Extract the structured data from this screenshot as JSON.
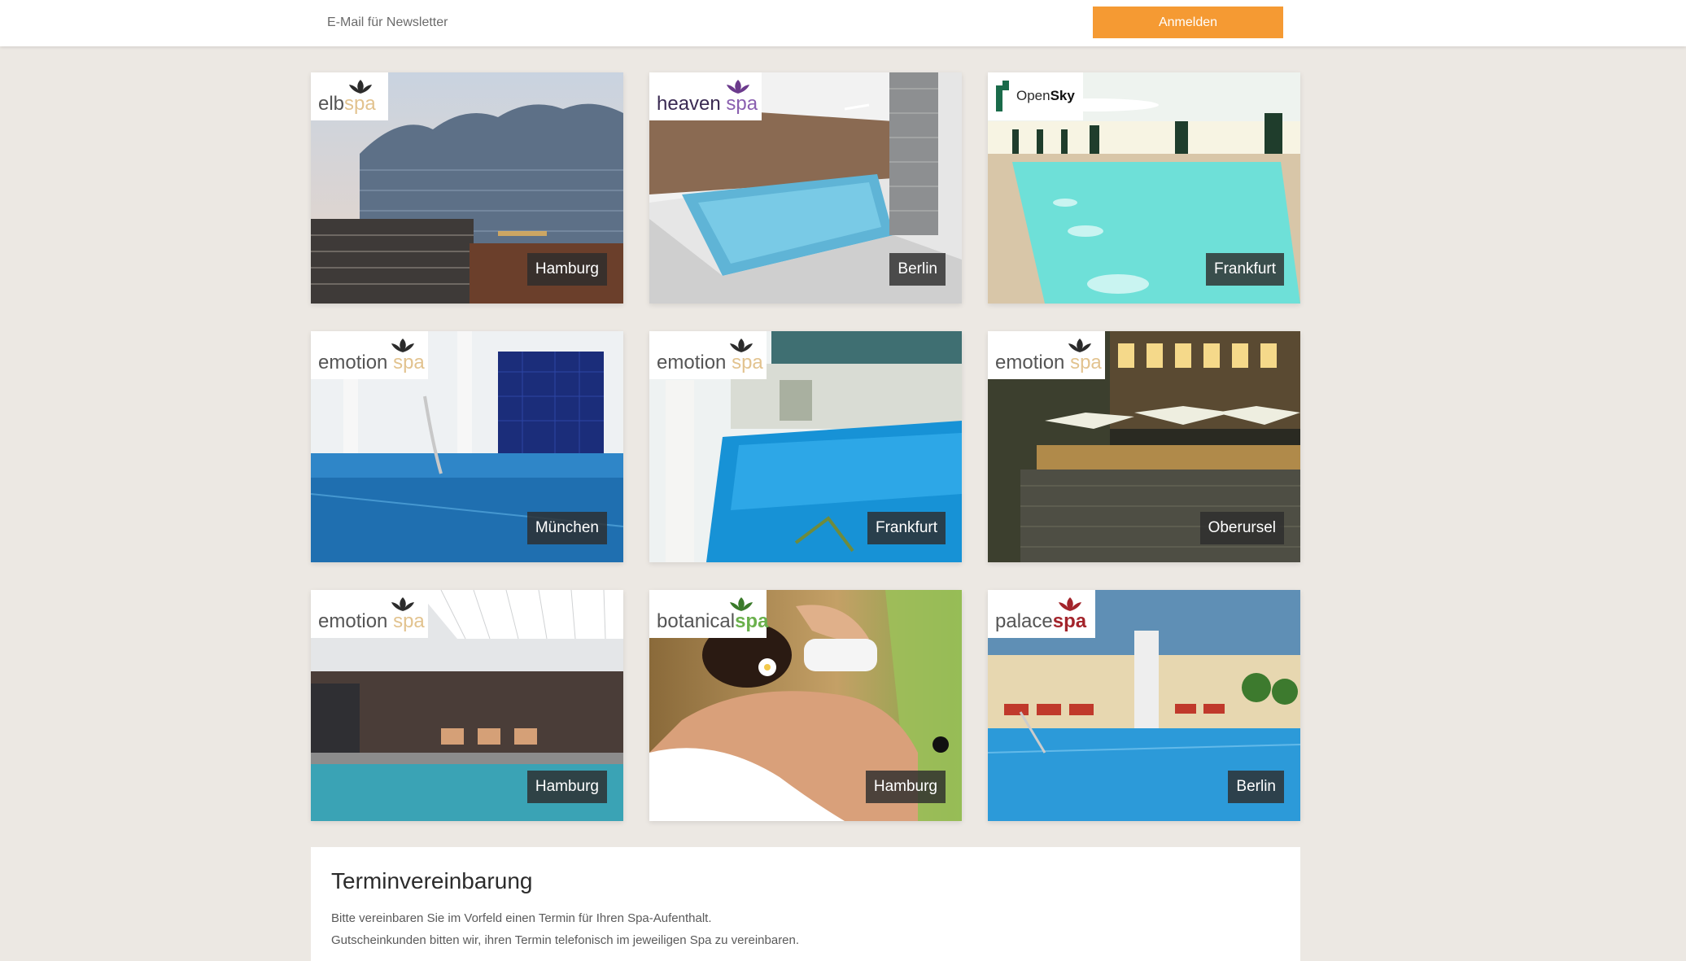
{
  "newsletter": {
    "placeholder": "E-Mail für Newsletter",
    "button_label": "Anmelden",
    "button_color": "#f59a33"
  },
  "spas": [
    {
      "brand_a": "elb",
      "brand_b": "spa",
      "city": "Hamburg",
      "brand_color": "#e2c38f",
      "icon": "lotus-icon"
    },
    {
      "brand_a": "heaven",
      "brand_b": "spa",
      "city": "Berlin",
      "brand_color": "#6b3a8c",
      "icon": "lotus-icon"
    },
    {
      "brand_a": "Open",
      "brand_b": "Sky",
      "city": "Frankfurt",
      "brand_color": "#1a6b4a",
      "icon": "opensky-icon"
    },
    {
      "brand_a": "emotion",
      "brand_b": "spa",
      "city": "München",
      "brand_color": "#e2c38f",
      "icon": "lotus-icon"
    },
    {
      "brand_a": "emotion",
      "brand_b": "spa",
      "city": "Frankfurt",
      "brand_color": "#e2c38f",
      "icon": "lotus-icon"
    },
    {
      "brand_a": "emotion",
      "brand_b": "spa",
      "city": "Oberursel",
      "brand_color": "#e2c38f",
      "icon": "lotus-icon"
    },
    {
      "brand_a": "emotion",
      "brand_b": "spa",
      "city": "Hamburg",
      "brand_color": "#e2c38f",
      "icon": "lotus-icon"
    },
    {
      "brand_a": "botanical",
      "brand_b": "spa",
      "city": "Hamburg",
      "brand_color": "#6ab04c",
      "icon": "lotus-icon"
    },
    {
      "brand_a": "palace",
      "brand_b": "spa",
      "city": "Berlin",
      "brand_color": "#a3242b",
      "icon": "lotus-icon"
    }
  ],
  "appointment": {
    "title": "Terminvereinbarung",
    "line1": "Bitte vereinbaren Sie im Vorfeld einen Termin für Ihren Spa-Aufenthalt.",
    "line2": "Gutscheinkunden bitten wir, ihren Termin telefonisch im jeweiligen Spa zu vereinbaren."
  }
}
